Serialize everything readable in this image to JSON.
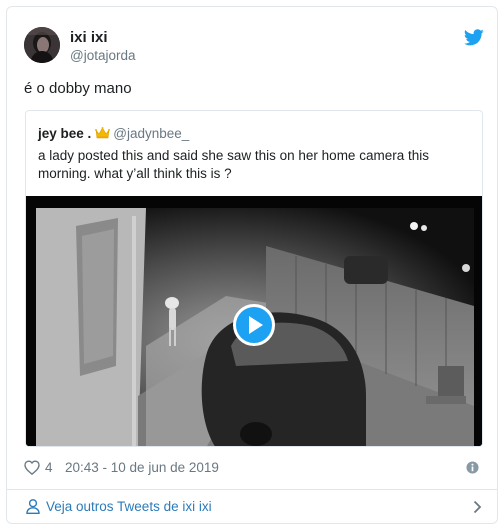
{
  "author": {
    "name": "ixi ixi",
    "handle": "@jotajorda"
  },
  "tweet": {
    "text": "é o dobby mano"
  },
  "quoted": {
    "name": "jey bee .",
    "emoji": "crown-emoji",
    "handle": "@jadynbee_",
    "text": "a lady posted this and said she saw this on her home camera this morning. what y’all think this is ?"
  },
  "media": {
    "type": "video",
    "play_icon": "play-icon"
  },
  "meta": {
    "likes": "4",
    "timestamp": "20:43 - 10 de jun de 2019"
  },
  "footer": {
    "label": "Veja outros Tweets de ixi ixi"
  },
  "colors": {
    "accent": "#1da1f2",
    "link": "#2b7bb9",
    "muted": "#697882",
    "border": "#e1e8ed"
  }
}
